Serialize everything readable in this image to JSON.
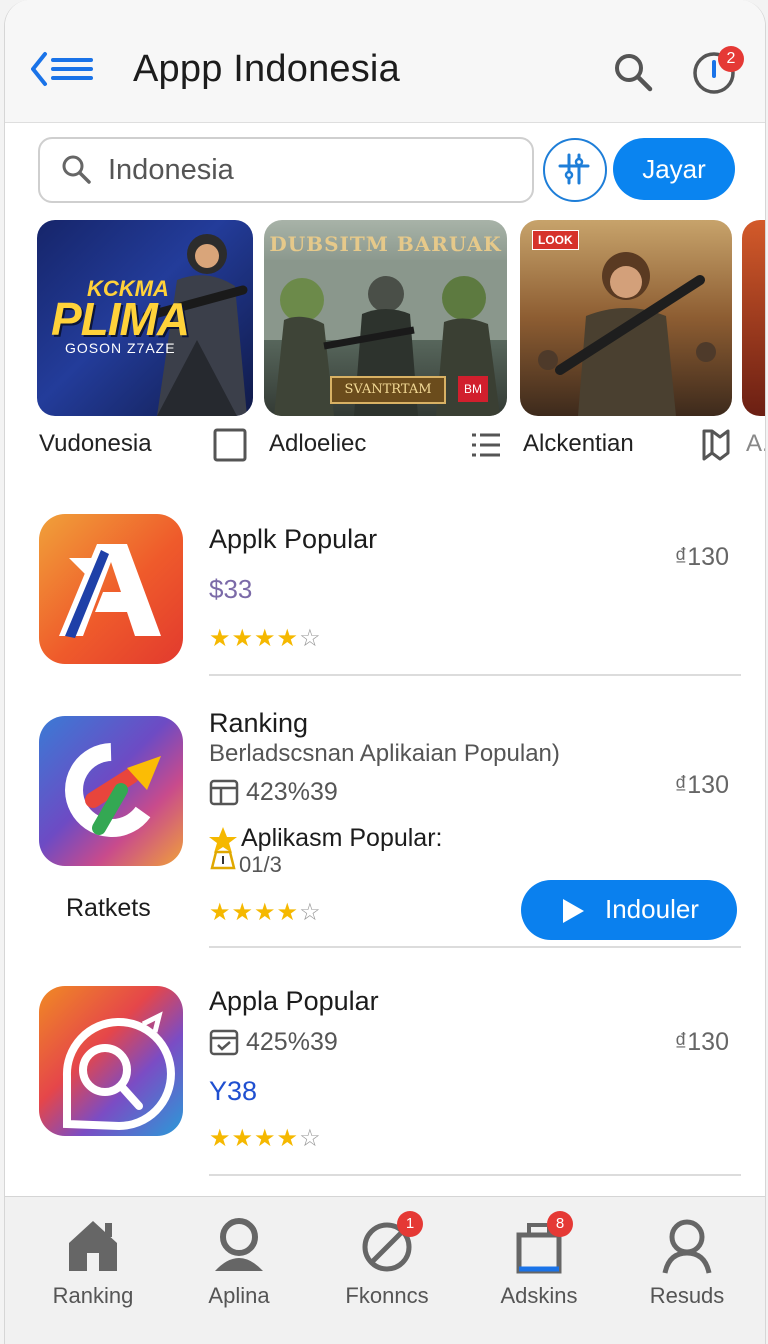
{
  "header": {
    "title": "Appp Indonesia",
    "notification_count": "2"
  },
  "search": {
    "value": "Indonesia",
    "primary_button": "Jayar"
  },
  "banners": [
    {
      "line1": "KCKMA",
      "line2": "PLIMA",
      "line3": "GOSON Z7AZE"
    },
    {
      "title": "DUBSITM BARUAK",
      "plaque": "SVANTRTAM",
      "badge": "BM"
    },
    {
      "tag": "LOOK"
    }
  ],
  "categories": [
    "Vudonesia",
    "Adloeliec",
    "Alckentian",
    "A."
  ],
  "apps": [
    {
      "name": "Applk Popular",
      "price_alt": "$33",
      "price": "₫130",
      "rating": 4
    },
    {
      "name": "Ranking",
      "subtitle": "Berladscsnan Aplikaian Populan)",
      "downloads": "423%39",
      "promo": "Aplikasm Popular:",
      "promo_value": "01/3",
      "side_label": "Ratkets",
      "price": "₫130",
      "rating": 4,
      "button": "Indouler"
    },
    {
      "name": "Appla Popular",
      "downloads": "425%39",
      "price_alt": "Y38",
      "price": "₫130",
      "rating": 4
    }
  ],
  "tabs": [
    {
      "label": "Ranking",
      "icon": "home-icon"
    },
    {
      "label": "Aplina",
      "icon": "person-icon"
    },
    {
      "label": "Fkonncs",
      "icon": "no-entry-icon",
      "badge": "1"
    },
    {
      "label": "Adskins",
      "icon": "bag-icon",
      "badge": "8"
    },
    {
      "label": "Resuds",
      "icon": "user-icon"
    }
  ],
  "colors": {
    "accent": "#0a84f0",
    "badge": "#e53935",
    "star": "#f5b800"
  }
}
